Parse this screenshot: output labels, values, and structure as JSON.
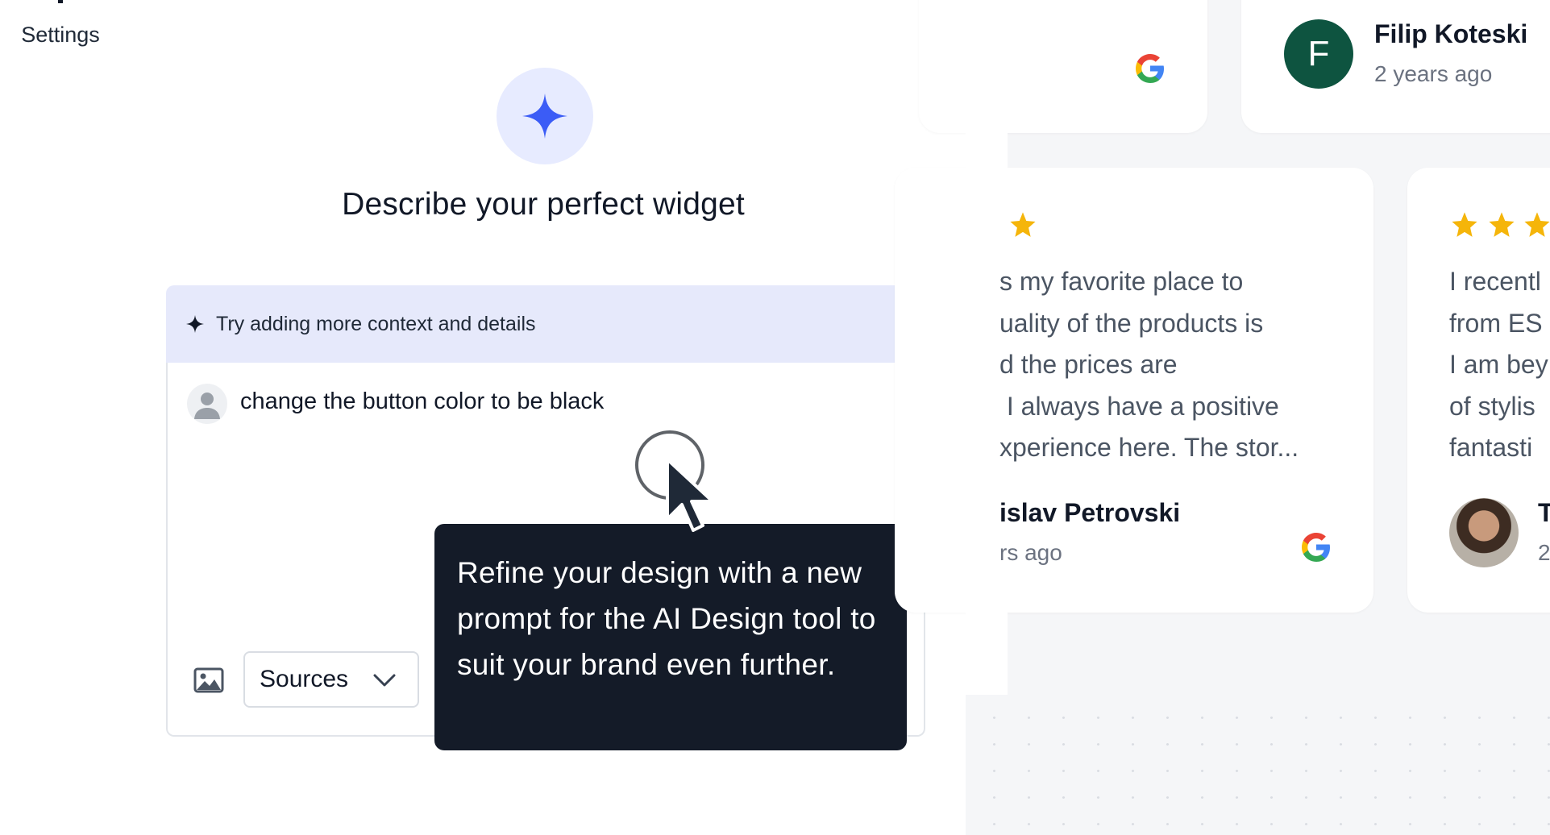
{
  "sidebar": {
    "settings_label": "Settings"
  },
  "editor": {
    "title": "Describe your perfect widget",
    "hint": "Try adding more context and details",
    "prompt_text": "change the button color to be black",
    "sources_label": "Sources"
  },
  "tooltip": {
    "text": "Refine your design with a new prompt for the AI Design tool to suit your brand even further."
  },
  "preview": {
    "top_reviewer": {
      "initial": "F",
      "name": "Filip Koteski",
      "time": "2 years ago"
    },
    "review_1": {
      "lines": [
        "s my favorite place to",
        "uality of the products is",
        "d the prices are",
        " I always have a positive",
        "xperience here. The stor..."
      ],
      "name": "islav Petrovski",
      "time": "rs ago"
    },
    "review_2": {
      "lines": [
        "I recentl",
        "from ES",
        "I am bey",
        "of stylis",
        "fantasti"
      ],
      "name_fragment": "T",
      "time_fragment": "2"
    }
  },
  "colors": {
    "accent": "#3b5cf6",
    "star": "#f5b50a",
    "tooltip_bg": "#141b28",
    "avatar_green": "#0e5440"
  },
  "icons": [
    "gear-icon",
    "sparkle-icon",
    "user-icon",
    "image-icon",
    "chevron-down-icon",
    "google-icon",
    "star-icon",
    "cursor-icon"
  ]
}
